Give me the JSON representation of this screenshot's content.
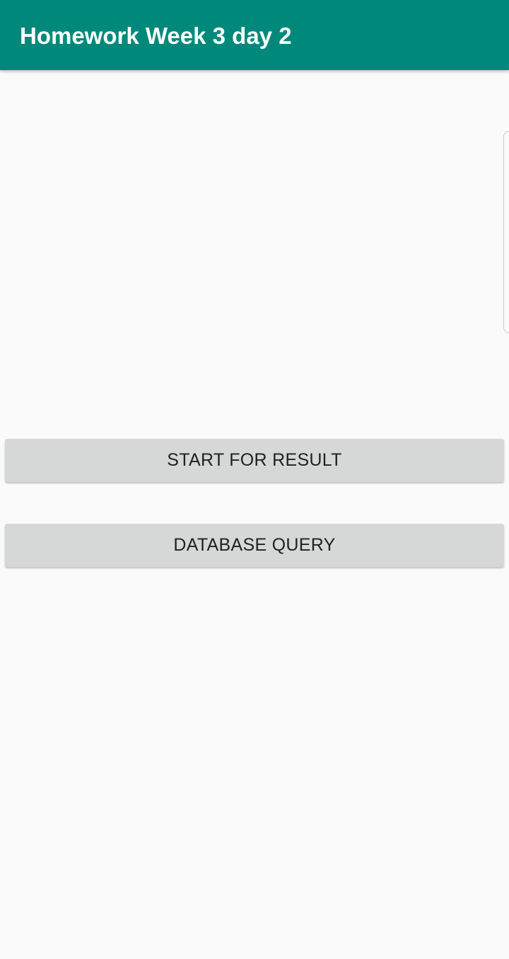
{
  "app_bar": {
    "title": "Homework Week 3 day 2",
    "background_color": "#00897b"
  },
  "buttons": {
    "start_for_result": "START FOR RESULT",
    "database_query": "DATABASE QUERY",
    "background_color": "#d6d7d7"
  }
}
